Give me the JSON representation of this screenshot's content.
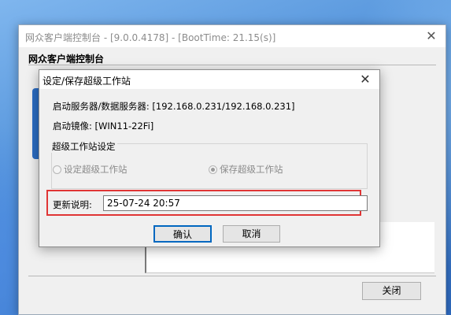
{
  "main_window": {
    "title": "网众客户端控制台 - [9.0.0.4178] - [BootTime: 21.15(s)]",
    "header": "网众客户端控制台",
    "close_glyph": "✕",
    "close_button": "关闭"
  },
  "dialog": {
    "title": "设定/保存超级工作站",
    "close_glyph": "✕",
    "server_line": "启动服务器/数据服务器: [192.168.0.231/192.168.0.231]",
    "image_line": "启动镜像: [WIN11-22Fi]",
    "group_label": "超级工作站设定",
    "radio_set": "设定超级工作站",
    "radio_save": "保存超级工作站",
    "update_label": "更新说明:",
    "update_value": "25-07-24 20:57",
    "ok": "确认",
    "cancel": "取消"
  },
  "colors": {
    "highlight": "#e03535",
    "focus_border": "#0067c0",
    "window_bg": "#f0f0f0"
  }
}
